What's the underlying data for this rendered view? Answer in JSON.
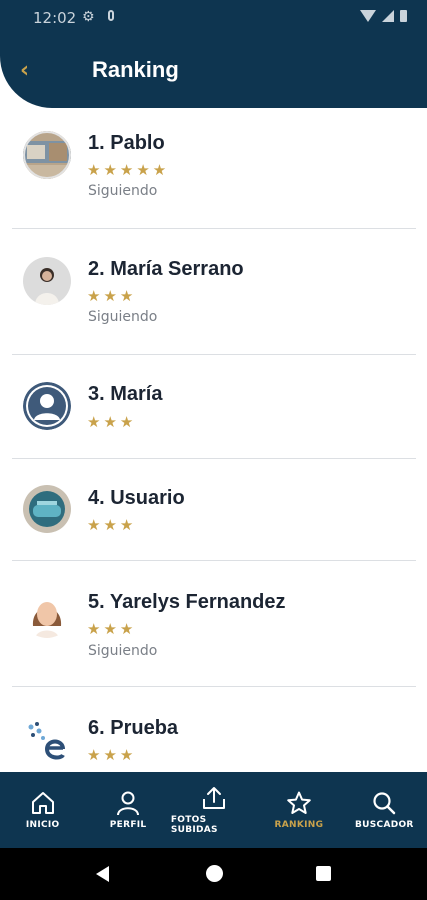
{
  "status_bar": {
    "time": "12:02"
  },
  "header": {
    "title": "Ranking"
  },
  "ranking": [
    {
      "name": "1. Pablo",
      "stars": "★★★★★",
      "status": "Siguiendo"
    },
    {
      "name": "2. María Serrano",
      "stars": "★★★",
      "status": "Siguiendo"
    },
    {
      "name": "3. María",
      "stars": "★★★",
      "status": ""
    },
    {
      "name": "4. Usuario",
      "stars": "★★★",
      "status": ""
    },
    {
      "name": "5. Yarelys Fernandez",
      "stars": "★★★",
      "status": "Siguiendo"
    },
    {
      "name": "6. Prueba",
      "stars": "★★★",
      "status": ""
    }
  ],
  "nav": {
    "items": [
      {
        "label": "INICIO",
        "icon": "home-icon"
      },
      {
        "label": "PERFIL",
        "icon": "user-icon"
      },
      {
        "label": "FOTOS SUBIDAS",
        "icon": "upload-icon"
      },
      {
        "label": "RANKING",
        "icon": "star-icon",
        "active": true
      },
      {
        "label": "BUSCADOR",
        "icon": "search-icon"
      }
    ]
  },
  "colors": {
    "primary": "#0e3550",
    "accent": "#c9a24b",
    "text": "#1c2533",
    "muted": "#7a7f87"
  }
}
